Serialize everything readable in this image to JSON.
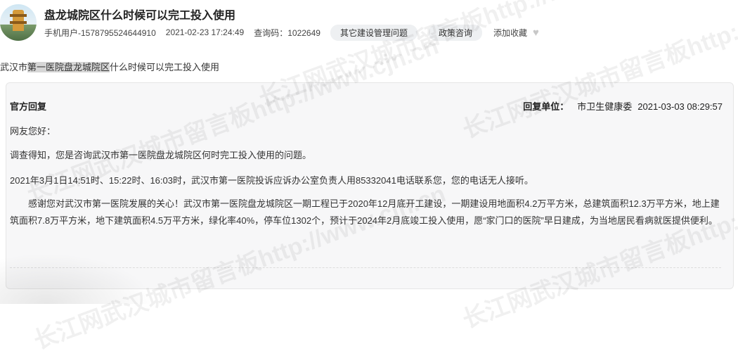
{
  "header": {
    "title": "盘龙城院区什么时候可以完工投入使用",
    "user": "手机用户-1578795524644910",
    "datetime": "2021-02-23 17:24:49",
    "query_code_label": "查询码：",
    "query_code": "1022649",
    "tags": [
      "其它建设管理问题",
      "政策咨询"
    ],
    "favorite_label": "添加收藏"
  },
  "question": {
    "prefix": "武汉市",
    "highlight": "第一医院盘龙城院区",
    "suffix": "什么时候可以完工投入使用"
  },
  "reply": {
    "label": "官方回复",
    "unit_label": "回复单位：",
    "unit": "市卫生健康委",
    "datetime": "2021-03-03 08:29:57",
    "greeting": "网友您好：",
    "p1": "调查得知，您是咨询武汉市第一医院盘龙城院区何时完工投入使用的问题。",
    "p2": "2021年3月1日14:51时、15:22时、16:03时，武汉市第一医院投诉应诉办公室负责人用85332041电话联系您，您的电话无人接听。",
    "p3": "感谢您对武汉市第一医院发展的关心！武汉市第一医院盘龙城院区一期工程已于2020年12月底开工建设，一期建设用地面积4.2万平方米，总建筑面积12.3万平方米，地上建筑面积7.8万平方米，地下建筑面积4.5万平方米，绿化率40%，停车位1302个，预计于2024年2月底竣工投入使用，愿“家门口的医院”早日建成，为当地居民看病就医提供便利。"
  },
  "watermark": {
    "text": "长江网武汉城市留言板http://www.cjn.cn"
  },
  "icons": {
    "favorite": "heart-icon"
  }
}
